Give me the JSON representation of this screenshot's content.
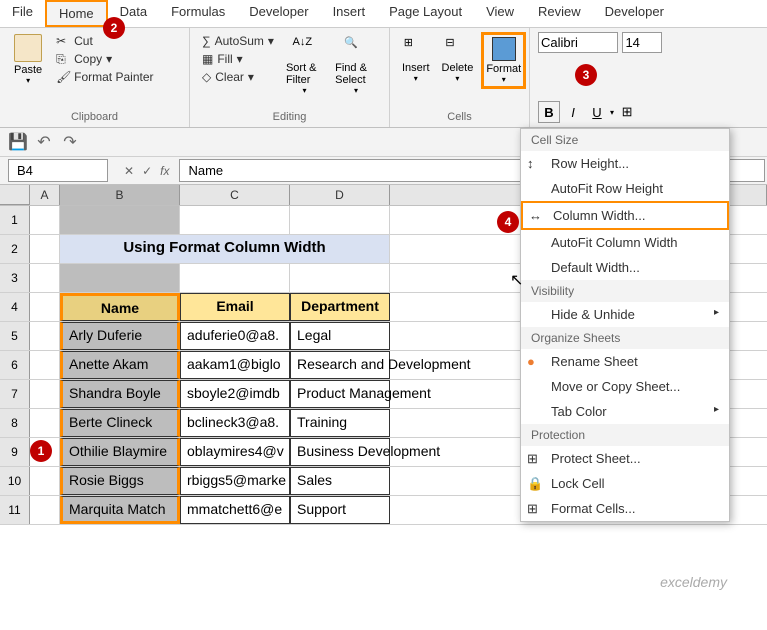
{
  "tabs": [
    "File",
    "Home",
    "Data",
    "Formulas",
    "Developer",
    "Insert",
    "Page Layout",
    "View",
    "Review",
    "Developer"
  ],
  "active_tab": "Home",
  "ribbon": {
    "paste": "Paste",
    "cut": "Cut",
    "copy": "Copy",
    "format_painter": "Format Painter",
    "clipboard_label": "Clipboard",
    "autosum": "AutoSum",
    "fill": "Fill",
    "clear": "Clear",
    "editing_label": "Editing",
    "sort": "Sort & Filter",
    "find": "Find & Select",
    "insert": "Insert",
    "delete": "Delete",
    "format": "Format",
    "cells_label": "Cells",
    "font_name": "Calibri",
    "font_size": "14"
  },
  "namebox": "B4",
  "formula_value": "Name",
  "chart_data": {
    "type": "table",
    "title": "Using Format Column Width",
    "columns": [
      "Name",
      "Email",
      "Department"
    ],
    "rows": [
      [
        "Arly Duferie",
        "aduferie0@a8.",
        "Legal"
      ],
      [
        "Anette Akam",
        "aakam1@biglo",
        "Research and Development"
      ],
      [
        "Shandra Boyle",
        "sboyle2@imdb",
        "Product Management"
      ],
      [
        "Berte Clineck",
        "bclineck3@a8.",
        "Training"
      ],
      [
        "Othilie Blaymire",
        "oblaymires4@v",
        "Business Development"
      ],
      [
        "Rosie Biggs",
        "rbiggs5@marke",
        "Sales"
      ],
      [
        "Marquita Match",
        "mmatchett6@e",
        "Support"
      ]
    ]
  },
  "menu": {
    "cell_size": "Cell Size",
    "row_height": "Row Height...",
    "autofit_row": "AutoFit Row Height",
    "column_width": "Column Width...",
    "autofit_col": "AutoFit Column Width",
    "default_width": "Default Width...",
    "visibility": "Visibility",
    "hide_unhide": "Hide & Unhide",
    "organize": "Organize Sheets",
    "rename": "Rename Sheet",
    "move_copy": "Move or Copy Sheet...",
    "tab_color": "Tab Color",
    "protection": "Protection",
    "protect_sheet": "Protect Sheet...",
    "lock_cell": "Lock Cell",
    "format_cells": "Format Cells..."
  },
  "watermark": "exceldemy",
  "badges": {
    "1": "1",
    "2": "2",
    "3": "3",
    "4": "4"
  }
}
